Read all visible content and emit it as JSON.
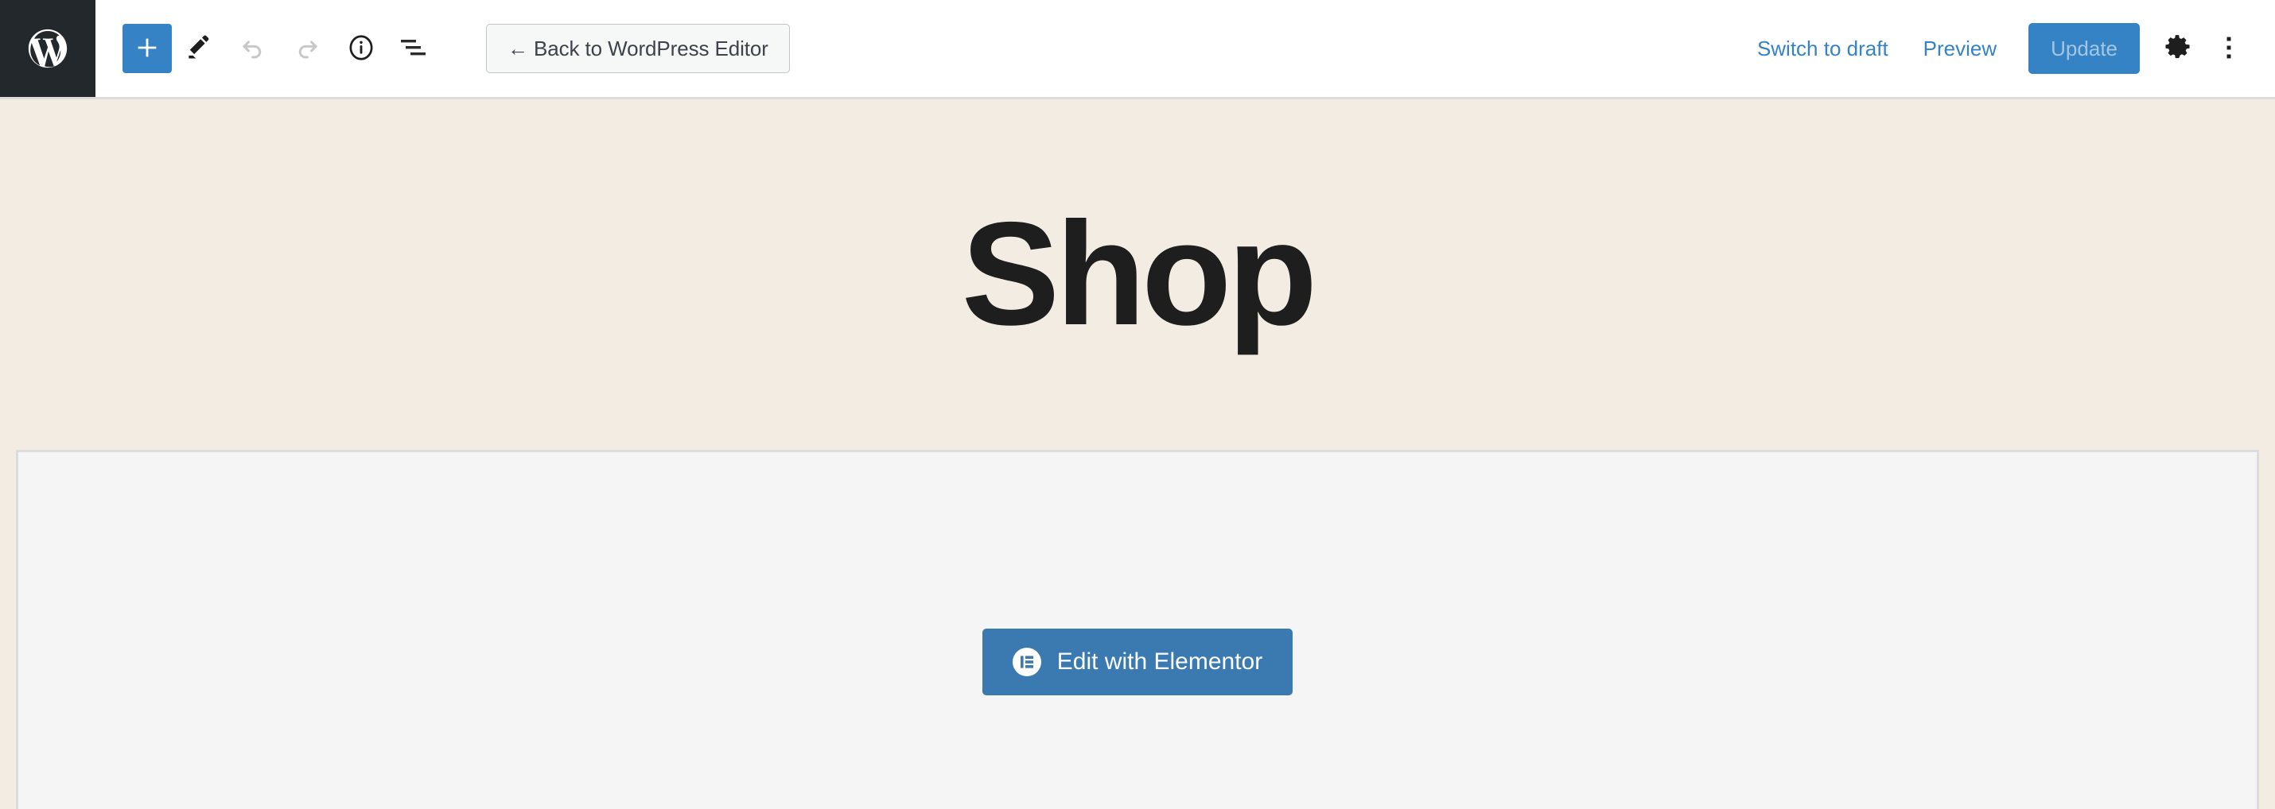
{
  "window": {
    "app": "WordPress Block Editor"
  },
  "header": {
    "wp_logo": {
      "icon": "wordpress-logo-icon",
      "label": "WordPress"
    },
    "left_tools": [
      {
        "id": "add-block",
        "icon": "plus-icon",
        "label": "Add block",
        "state": "active"
      },
      {
        "id": "tools",
        "icon": "pencil-icon",
        "label": "Tools",
        "state": "enabled"
      },
      {
        "id": "undo",
        "icon": "undo-arrow-icon",
        "label": "Undo",
        "state": "disabled"
      },
      {
        "id": "redo",
        "icon": "redo-arrow-icon",
        "label": "Redo",
        "state": "disabled"
      },
      {
        "id": "details",
        "icon": "info-circle-icon",
        "label": "Details",
        "state": "enabled"
      },
      {
        "id": "list-view",
        "icon": "list-view-icon",
        "label": "List View",
        "state": "enabled"
      }
    ],
    "back_button": {
      "label": "← Back to WordPress Editor",
      "arrow": "←",
      "text": "Back to WordPress Editor"
    },
    "right_actions": {
      "switch_to_draft": "Switch to draft",
      "preview": "Preview",
      "update": "Update",
      "update_state": "disabled",
      "settings": {
        "icon": "gear-icon",
        "label": "Settings"
      },
      "options": {
        "icon": "vertical-ellipsis-icon",
        "label": "Options"
      }
    }
  },
  "canvas": {
    "hero": {
      "title": "Shop",
      "background_color": "#f3ece2",
      "text_color": "#1e1e1e"
    },
    "content_block": {
      "background_color": "#f5f5f6",
      "border_color": "#dcdcde",
      "elementor_button": {
        "label": "Edit with Elementor",
        "icon": "elementor-logo-icon",
        "background_color": "#3a7ab0"
      }
    }
  },
  "colors": {
    "wp_admin_dark": "#23282d",
    "accent_blue": "#3582c4",
    "elementor_blue": "#3a7ab0",
    "cream": "#f3ece2",
    "panel_gray": "#f5f5f6",
    "border_gray": "#dcdcde",
    "link_blue": "#3582c4"
  }
}
